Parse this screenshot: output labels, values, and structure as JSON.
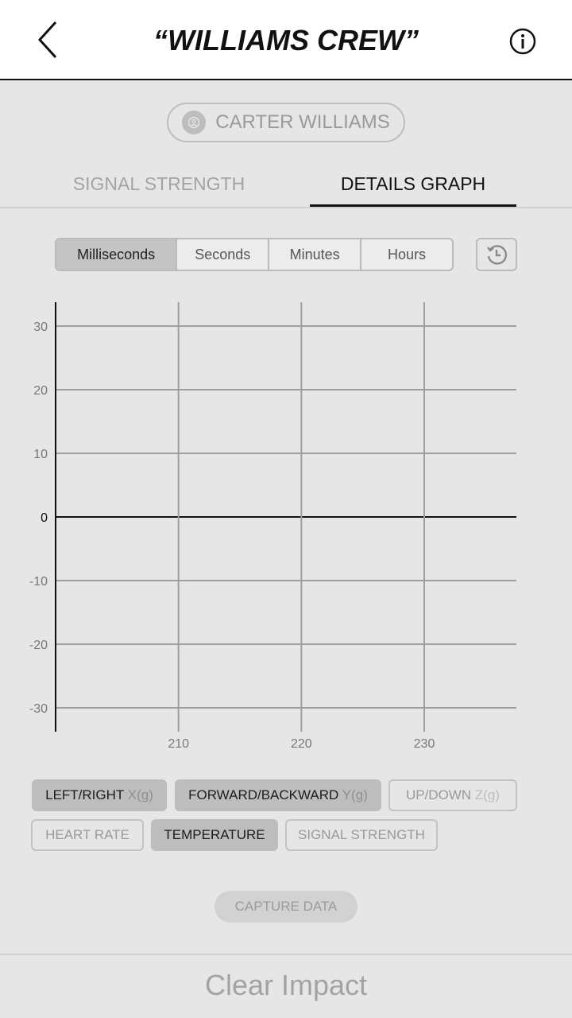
{
  "header": {
    "title": "“WILLIAMS CREW”"
  },
  "user": {
    "name": "CARTER WILLIAMS"
  },
  "tabs": [
    {
      "label": "SIGNAL STRENGTH",
      "active": false
    },
    {
      "label": "DETAILS GRAPH",
      "active": true
    }
  ],
  "time_units": [
    "Milliseconds",
    "Seconds",
    "Minutes",
    "Hours"
  ],
  "selected_time_unit": "Milliseconds",
  "chart_data": {
    "type": "line",
    "title": "",
    "xlabel": "",
    "ylabel": "",
    "x_ticks": [
      210,
      220,
      230
    ],
    "y_ticks": [
      30,
      20,
      10,
      0,
      -10,
      -20,
      -30
    ],
    "xlim": [
      200,
      237.5
    ],
    "ylim": [
      -33.75,
      33.75
    ],
    "grid": true,
    "series": []
  },
  "filters": [
    {
      "label": "LEFT/RIGHT",
      "unit": "X(g)",
      "selected": true
    },
    {
      "label": "FORWARD/BACKWARD",
      "unit": "Y(g)",
      "selected": true
    },
    {
      "label": "UP/DOWN",
      "unit": "Z(g)",
      "selected": false
    },
    {
      "label": "HEART RATE",
      "unit": "",
      "selected": false
    },
    {
      "label": "TEMPERATURE",
      "unit": "",
      "selected": true
    },
    {
      "label": "SIGNAL STRENGTH",
      "unit": "",
      "selected": false
    }
  ],
  "capture_label": "CAPTURE DATA",
  "footer_label": "Clear Impact",
  "colors": {
    "grid": "#9e9e9e",
    "axis": "#111111",
    "selected_chip": "#bdbdbd"
  }
}
